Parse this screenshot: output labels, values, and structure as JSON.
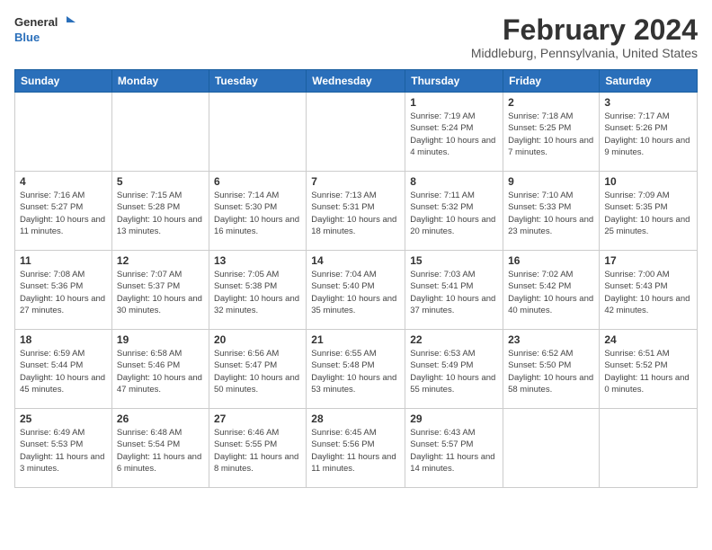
{
  "header": {
    "logo_line1": "General",
    "logo_line2": "Blue",
    "month": "February 2024",
    "location": "Middleburg, Pennsylvania, United States"
  },
  "weekdays": [
    "Sunday",
    "Monday",
    "Tuesday",
    "Wednesday",
    "Thursday",
    "Friday",
    "Saturday"
  ],
  "weeks": [
    [
      {
        "day": "",
        "info": ""
      },
      {
        "day": "",
        "info": ""
      },
      {
        "day": "",
        "info": ""
      },
      {
        "day": "",
        "info": ""
      },
      {
        "day": "1",
        "info": "Sunrise: 7:19 AM\nSunset: 5:24 PM\nDaylight: 10 hours\nand 4 minutes."
      },
      {
        "day": "2",
        "info": "Sunrise: 7:18 AM\nSunset: 5:25 PM\nDaylight: 10 hours\nand 7 minutes."
      },
      {
        "day": "3",
        "info": "Sunrise: 7:17 AM\nSunset: 5:26 PM\nDaylight: 10 hours\nand 9 minutes."
      }
    ],
    [
      {
        "day": "4",
        "info": "Sunrise: 7:16 AM\nSunset: 5:27 PM\nDaylight: 10 hours\nand 11 minutes."
      },
      {
        "day": "5",
        "info": "Sunrise: 7:15 AM\nSunset: 5:28 PM\nDaylight: 10 hours\nand 13 minutes."
      },
      {
        "day": "6",
        "info": "Sunrise: 7:14 AM\nSunset: 5:30 PM\nDaylight: 10 hours\nand 16 minutes."
      },
      {
        "day": "7",
        "info": "Sunrise: 7:13 AM\nSunset: 5:31 PM\nDaylight: 10 hours\nand 18 minutes."
      },
      {
        "day": "8",
        "info": "Sunrise: 7:11 AM\nSunset: 5:32 PM\nDaylight: 10 hours\nand 20 minutes."
      },
      {
        "day": "9",
        "info": "Sunrise: 7:10 AM\nSunset: 5:33 PM\nDaylight: 10 hours\nand 23 minutes."
      },
      {
        "day": "10",
        "info": "Sunrise: 7:09 AM\nSunset: 5:35 PM\nDaylight: 10 hours\nand 25 minutes."
      }
    ],
    [
      {
        "day": "11",
        "info": "Sunrise: 7:08 AM\nSunset: 5:36 PM\nDaylight: 10 hours\nand 27 minutes."
      },
      {
        "day": "12",
        "info": "Sunrise: 7:07 AM\nSunset: 5:37 PM\nDaylight: 10 hours\nand 30 minutes."
      },
      {
        "day": "13",
        "info": "Sunrise: 7:05 AM\nSunset: 5:38 PM\nDaylight: 10 hours\nand 32 minutes."
      },
      {
        "day": "14",
        "info": "Sunrise: 7:04 AM\nSunset: 5:40 PM\nDaylight: 10 hours\nand 35 minutes."
      },
      {
        "day": "15",
        "info": "Sunrise: 7:03 AM\nSunset: 5:41 PM\nDaylight: 10 hours\nand 37 minutes."
      },
      {
        "day": "16",
        "info": "Sunrise: 7:02 AM\nSunset: 5:42 PM\nDaylight: 10 hours\nand 40 minutes."
      },
      {
        "day": "17",
        "info": "Sunrise: 7:00 AM\nSunset: 5:43 PM\nDaylight: 10 hours\nand 42 minutes."
      }
    ],
    [
      {
        "day": "18",
        "info": "Sunrise: 6:59 AM\nSunset: 5:44 PM\nDaylight: 10 hours\nand 45 minutes."
      },
      {
        "day": "19",
        "info": "Sunrise: 6:58 AM\nSunset: 5:46 PM\nDaylight: 10 hours\nand 47 minutes."
      },
      {
        "day": "20",
        "info": "Sunrise: 6:56 AM\nSunset: 5:47 PM\nDaylight: 10 hours\nand 50 minutes."
      },
      {
        "day": "21",
        "info": "Sunrise: 6:55 AM\nSunset: 5:48 PM\nDaylight: 10 hours\nand 53 minutes."
      },
      {
        "day": "22",
        "info": "Sunrise: 6:53 AM\nSunset: 5:49 PM\nDaylight: 10 hours\nand 55 minutes."
      },
      {
        "day": "23",
        "info": "Sunrise: 6:52 AM\nSunset: 5:50 PM\nDaylight: 10 hours\nand 58 minutes."
      },
      {
        "day": "24",
        "info": "Sunrise: 6:51 AM\nSunset: 5:52 PM\nDaylight: 11 hours\nand 0 minutes."
      }
    ],
    [
      {
        "day": "25",
        "info": "Sunrise: 6:49 AM\nSunset: 5:53 PM\nDaylight: 11 hours\nand 3 minutes."
      },
      {
        "day": "26",
        "info": "Sunrise: 6:48 AM\nSunset: 5:54 PM\nDaylight: 11 hours\nand 6 minutes."
      },
      {
        "day": "27",
        "info": "Sunrise: 6:46 AM\nSunset: 5:55 PM\nDaylight: 11 hours\nand 8 minutes."
      },
      {
        "day": "28",
        "info": "Sunrise: 6:45 AM\nSunset: 5:56 PM\nDaylight: 11 hours\nand 11 minutes."
      },
      {
        "day": "29",
        "info": "Sunrise: 6:43 AM\nSunset: 5:57 PM\nDaylight: 11 hours\nand 14 minutes."
      },
      {
        "day": "",
        "info": ""
      },
      {
        "day": "",
        "info": ""
      }
    ]
  ]
}
